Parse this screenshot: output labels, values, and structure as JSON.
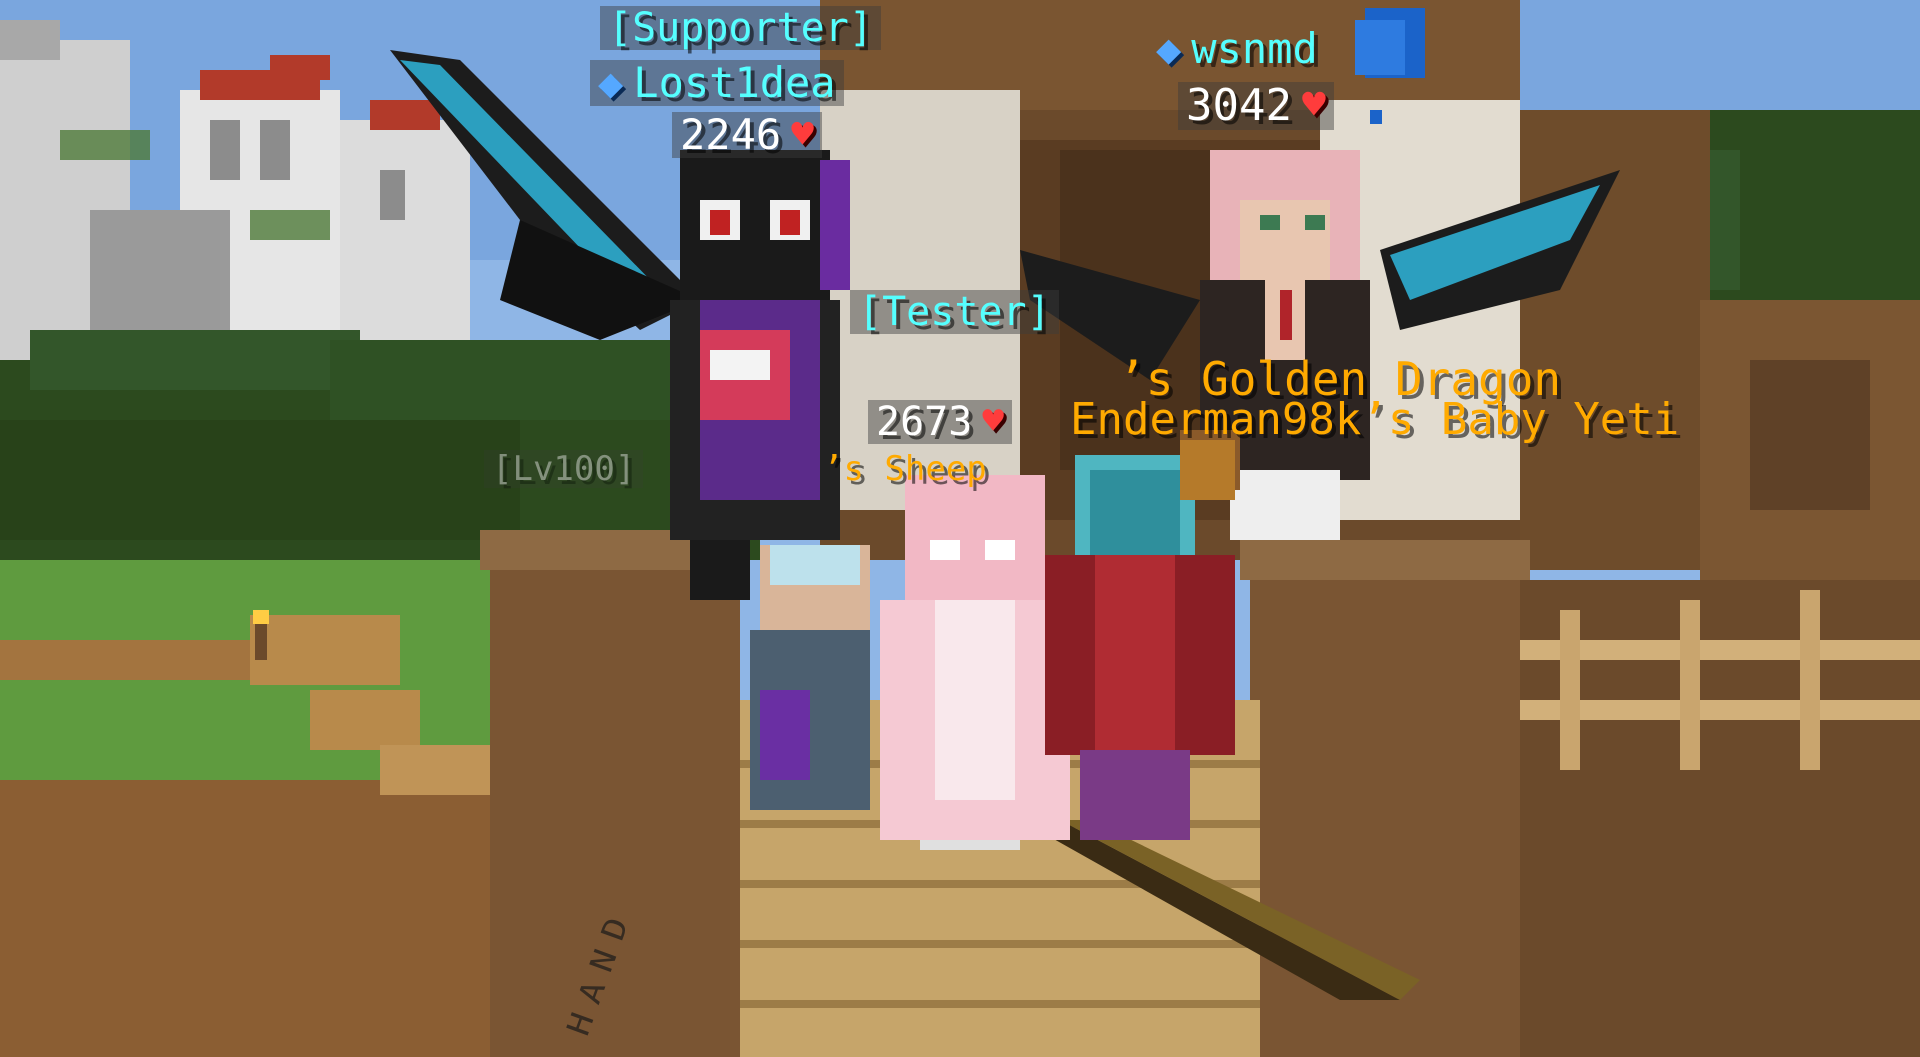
{
  "scene": {
    "colors": {
      "sky": "#8fb6e6",
      "leaves": "#2c4a1e",
      "wood": "#6b4a2b",
      "planks": "#b8955c",
      "supporter_rank": "#55ffff",
      "tester_rank": "#55ffff",
      "player_name": "#55ffff",
      "pet_name": "#ffaa00",
      "level_tag": "#aaaaaa",
      "health_text": "#ffffff",
      "heart": "#ff3c3c"
    },
    "icons": {
      "rank_marker": "diamond-icon",
      "health": "heart-icon"
    }
  },
  "nametags": {
    "supporter": {
      "rank": "[Supporter]",
      "name": "Lost1dea",
      "health": "2246"
    },
    "wsnmd": {
      "name": "wsnmd",
      "health": "3042"
    },
    "tester": {
      "rank": "[Tester]",
      "health": "2673"
    },
    "pets": {
      "golden_dragon": "’s Golden Dragon",
      "baby_yeti": "Enderman98k’s Baby Yeti",
      "sheep_level": "[Lv100]",
      "sheep_name": "’s Sheep"
    }
  }
}
